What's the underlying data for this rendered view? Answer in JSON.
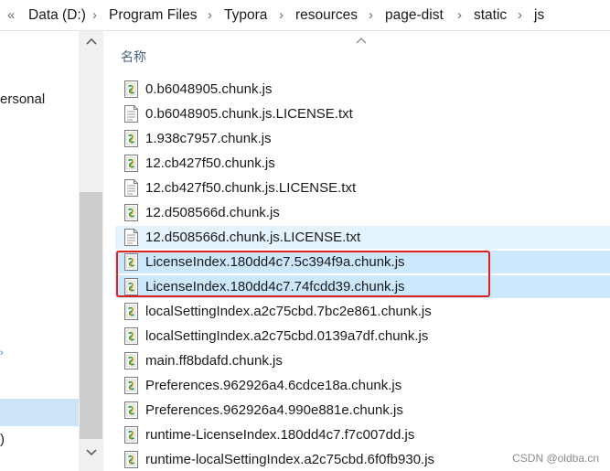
{
  "breadcrumb": {
    "chevron": "«",
    "separator": "›",
    "items": [
      "Data (D:)",
      "Program Files",
      "Typora",
      "resources",
      "page-dist",
      "static",
      "js"
    ]
  },
  "nav": {
    "items": [
      "ersonal",
      ")"
    ]
  },
  "list": {
    "column_name": "名称",
    "files": [
      {
        "name": "0.b6048905.chunk.js",
        "type": "js"
      },
      {
        "name": "0.b6048905.chunk.js.LICENSE.txt",
        "type": "txt"
      },
      {
        "name": "1.938c7957.chunk.js",
        "type": "js"
      },
      {
        "name": "12.cb427f50.chunk.js",
        "type": "js"
      },
      {
        "name": "12.cb427f50.chunk.js.LICENSE.txt",
        "type": "txt"
      },
      {
        "name": "12.d508566d.chunk.js",
        "type": "js"
      },
      {
        "name": "12.d508566d.chunk.js.LICENSE.txt",
        "type": "txt"
      },
      {
        "name": "LicenseIndex.180dd4c7.5c394f9a.chunk.js",
        "type": "js"
      },
      {
        "name": "LicenseIndex.180dd4c7.74fcdd39.chunk.js",
        "type": "js"
      },
      {
        "name": "localSettingIndex.a2c75cbd.7bc2e861.chunk.js",
        "type": "js"
      },
      {
        "name": "localSettingIndex.a2c75cbd.0139a7df.chunk.js",
        "type": "js"
      },
      {
        "name": "main.ff8bdafd.chunk.js",
        "type": "js"
      },
      {
        "name": "Preferences.962926a4.6cdce18a.chunk.js",
        "type": "js"
      },
      {
        "name": "Preferences.962926a4.990e881e.chunk.js",
        "type": "js"
      },
      {
        "name": "runtime-LicenseIndex.180dd4c7.f7c007dd.js",
        "type": "js"
      },
      {
        "name": "runtime-localSettingIndex.a2c75cbd.6f0fb930.js",
        "type": "js"
      }
    ]
  },
  "watermark": "CSDN @oldba.cn",
  "colors": {
    "selection": "#cce8ff",
    "hover": "#e5f3ff",
    "highlight_box": "#e02020"
  }
}
